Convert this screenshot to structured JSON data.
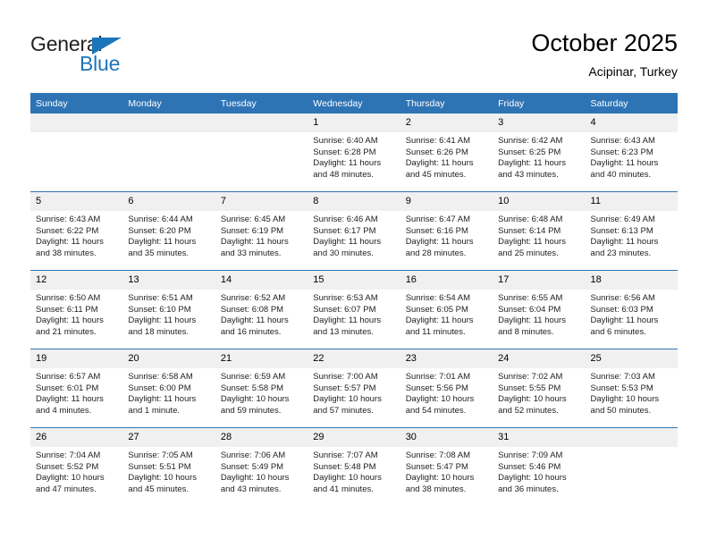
{
  "brand": {
    "name_part1": "General",
    "name_part2": "Blue",
    "triangle_icon": "triangle-icon",
    "color_dark": "#231f20",
    "color_blue": "#1b75bb"
  },
  "header": {
    "title": "October 2025",
    "subtitle": "Acipinar, Turkey",
    "accent_color": "#2e74b5"
  },
  "weekday_headers": [
    "Sunday",
    "Monday",
    "Tuesday",
    "Wednesday",
    "Thursday",
    "Friday",
    "Saturday"
  ],
  "weeks": [
    [
      {
        "day": "",
        "sunrise": "",
        "sunset": "",
        "daylight": ""
      },
      {
        "day": "",
        "sunrise": "",
        "sunset": "",
        "daylight": ""
      },
      {
        "day": "",
        "sunrise": "",
        "sunset": "",
        "daylight": ""
      },
      {
        "day": "1",
        "sunrise": "Sunrise: 6:40 AM",
        "sunset": "Sunset: 6:28 PM",
        "daylight": "Daylight: 11 hours and 48 minutes."
      },
      {
        "day": "2",
        "sunrise": "Sunrise: 6:41 AM",
        "sunset": "Sunset: 6:26 PM",
        "daylight": "Daylight: 11 hours and 45 minutes."
      },
      {
        "day": "3",
        "sunrise": "Sunrise: 6:42 AM",
        "sunset": "Sunset: 6:25 PM",
        "daylight": "Daylight: 11 hours and 43 minutes."
      },
      {
        "day": "4",
        "sunrise": "Sunrise: 6:43 AM",
        "sunset": "Sunset: 6:23 PM",
        "daylight": "Daylight: 11 hours and 40 minutes."
      }
    ],
    [
      {
        "day": "5",
        "sunrise": "Sunrise: 6:43 AM",
        "sunset": "Sunset: 6:22 PM",
        "daylight": "Daylight: 11 hours and 38 minutes."
      },
      {
        "day": "6",
        "sunrise": "Sunrise: 6:44 AM",
        "sunset": "Sunset: 6:20 PM",
        "daylight": "Daylight: 11 hours and 35 minutes."
      },
      {
        "day": "7",
        "sunrise": "Sunrise: 6:45 AM",
        "sunset": "Sunset: 6:19 PM",
        "daylight": "Daylight: 11 hours and 33 minutes."
      },
      {
        "day": "8",
        "sunrise": "Sunrise: 6:46 AM",
        "sunset": "Sunset: 6:17 PM",
        "daylight": "Daylight: 11 hours and 30 minutes."
      },
      {
        "day": "9",
        "sunrise": "Sunrise: 6:47 AM",
        "sunset": "Sunset: 6:16 PM",
        "daylight": "Daylight: 11 hours and 28 minutes."
      },
      {
        "day": "10",
        "sunrise": "Sunrise: 6:48 AM",
        "sunset": "Sunset: 6:14 PM",
        "daylight": "Daylight: 11 hours and 25 minutes."
      },
      {
        "day": "11",
        "sunrise": "Sunrise: 6:49 AM",
        "sunset": "Sunset: 6:13 PM",
        "daylight": "Daylight: 11 hours and 23 minutes."
      }
    ],
    [
      {
        "day": "12",
        "sunrise": "Sunrise: 6:50 AM",
        "sunset": "Sunset: 6:11 PM",
        "daylight": "Daylight: 11 hours and 21 minutes."
      },
      {
        "day": "13",
        "sunrise": "Sunrise: 6:51 AM",
        "sunset": "Sunset: 6:10 PM",
        "daylight": "Daylight: 11 hours and 18 minutes."
      },
      {
        "day": "14",
        "sunrise": "Sunrise: 6:52 AM",
        "sunset": "Sunset: 6:08 PM",
        "daylight": "Daylight: 11 hours and 16 minutes."
      },
      {
        "day": "15",
        "sunrise": "Sunrise: 6:53 AM",
        "sunset": "Sunset: 6:07 PM",
        "daylight": "Daylight: 11 hours and 13 minutes."
      },
      {
        "day": "16",
        "sunrise": "Sunrise: 6:54 AM",
        "sunset": "Sunset: 6:05 PM",
        "daylight": "Daylight: 11 hours and 11 minutes."
      },
      {
        "day": "17",
        "sunrise": "Sunrise: 6:55 AM",
        "sunset": "Sunset: 6:04 PM",
        "daylight": "Daylight: 11 hours and 8 minutes."
      },
      {
        "day": "18",
        "sunrise": "Sunrise: 6:56 AM",
        "sunset": "Sunset: 6:03 PM",
        "daylight": "Daylight: 11 hours and 6 minutes."
      }
    ],
    [
      {
        "day": "19",
        "sunrise": "Sunrise: 6:57 AM",
        "sunset": "Sunset: 6:01 PM",
        "daylight": "Daylight: 11 hours and 4 minutes."
      },
      {
        "day": "20",
        "sunrise": "Sunrise: 6:58 AM",
        "sunset": "Sunset: 6:00 PM",
        "daylight": "Daylight: 11 hours and 1 minute."
      },
      {
        "day": "21",
        "sunrise": "Sunrise: 6:59 AM",
        "sunset": "Sunset: 5:58 PM",
        "daylight": "Daylight: 10 hours and 59 minutes."
      },
      {
        "day": "22",
        "sunrise": "Sunrise: 7:00 AM",
        "sunset": "Sunset: 5:57 PM",
        "daylight": "Daylight: 10 hours and 57 minutes."
      },
      {
        "day": "23",
        "sunrise": "Sunrise: 7:01 AM",
        "sunset": "Sunset: 5:56 PM",
        "daylight": "Daylight: 10 hours and 54 minutes."
      },
      {
        "day": "24",
        "sunrise": "Sunrise: 7:02 AM",
        "sunset": "Sunset: 5:55 PM",
        "daylight": "Daylight: 10 hours and 52 minutes."
      },
      {
        "day": "25",
        "sunrise": "Sunrise: 7:03 AM",
        "sunset": "Sunset: 5:53 PM",
        "daylight": "Daylight: 10 hours and 50 minutes."
      }
    ],
    [
      {
        "day": "26",
        "sunrise": "Sunrise: 7:04 AM",
        "sunset": "Sunset: 5:52 PM",
        "daylight": "Daylight: 10 hours and 47 minutes."
      },
      {
        "day": "27",
        "sunrise": "Sunrise: 7:05 AM",
        "sunset": "Sunset: 5:51 PM",
        "daylight": "Daylight: 10 hours and 45 minutes."
      },
      {
        "day": "28",
        "sunrise": "Sunrise: 7:06 AM",
        "sunset": "Sunset: 5:49 PM",
        "daylight": "Daylight: 10 hours and 43 minutes."
      },
      {
        "day": "29",
        "sunrise": "Sunrise: 7:07 AM",
        "sunset": "Sunset: 5:48 PM",
        "daylight": "Daylight: 10 hours and 41 minutes."
      },
      {
        "day": "30",
        "sunrise": "Sunrise: 7:08 AM",
        "sunset": "Sunset: 5:47 PM",
        "daylight": "Daylight: 10 hours and 38 minutes."
      },
      {
        "day": "31",
        "sunrise": "Sunrise: 7:09 AM",
        "sunset": "Sunset: 5:46 PM",
        "daylight": "Daylight: 10 hours and 36 minutes."
      },
      {
        "day": "",
        "sunrise": "",
        "sunset": "",
        "daylight": ""
      }
    ]
  ]
}
